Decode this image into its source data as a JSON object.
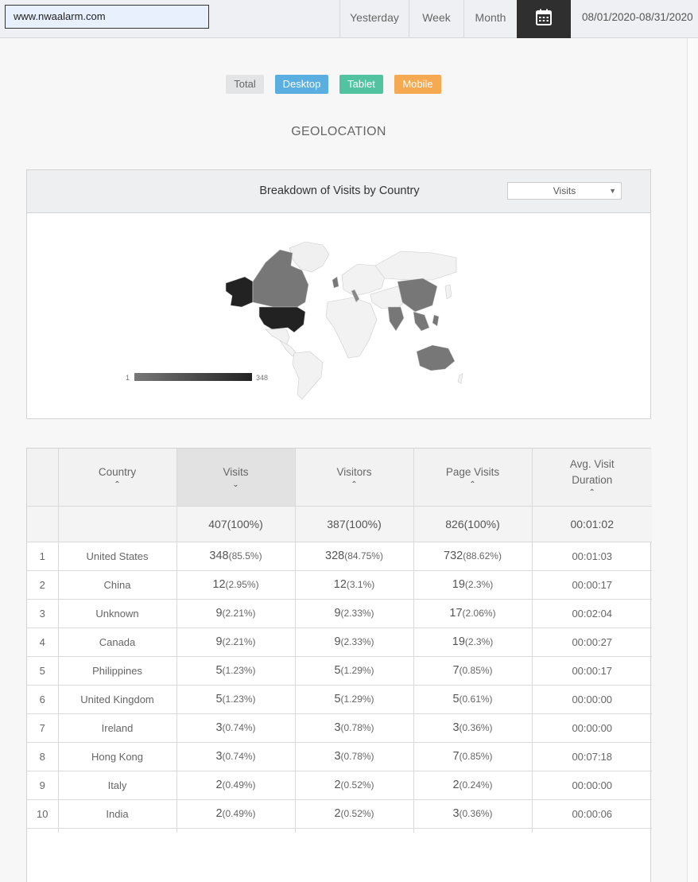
{
  "header": {
    "site": "www.nwaalarm.com",
    "nav": [
      "Yesterday",
      "Week",
      "Month"
    ],
    "calendar_icon": "calendar-icon",
    "date_range": "08/01/2020-08/31/2020"
  },
  "filters": [
    "Total",
    "Desktop",
    "Tablet",
    "Mobile"
  ],
  "filter_colors": {
    "total": "#e2e4e6",
    "desktop": "#5aaee0",
    "tablet": "#52c3a0",
    "mobile": "#f5a950"
  },
  "section_title": "GEOLOCATION",
  "map_panel": {
    "title": "Breakdown of Visits by Country",
    "metric_selected": "Visits",
    "legend_min": "1",
    "legend_max": "348"
  },
  "table": {
    "columns": [
      "",
      "Country",
      "Visits",
      "Visitors",
      "Page Visits",
      "Avg. Visit Duration"
    ],
    "totals": {
      "visits": {
        "n": "407",
        "p": "(100%)"
      },
      "visitors": {
        "n": "387",
        "p": "(100%)"
      },
      "page_visits": {
        "n": "826",
        "p": "(100%)"
      },
      "duration": "00:01:02"
    },
    "rows": [
      {
        "idx": "1",
        "country": "United States",
        "visits": {
          "n": "348",
          "p": "(85.5%)"
        },
        "visitors": {
          "n": "328",
          "p": "(84.75%)"
        },
        "page_visits": {
          "n": "732",
          "p": "(88.62%)"
        },
        "duration": "00:01:03"
      },
      {
        "idx": "2",
        "country": "China",
        "visits": {
          "n": "12",
          "p": "(2.95%)"
        },
        "visitors": {
          "n": "12",
          "p": "(3.1%)"
        },
        "page_visits": {
          "n": "19",
          "p": "(2.3%)"
        },
        "duration": "00:00:17"
      },
      {
        "idx": "3",
        "country": "Unknown",
        "visits": {
          "n": "9",
          "p": "(2.21%)"
        },
        "visitors": {
          "n": "9",
          "p": "(2.33%)"
        },
        "page_visits": {
          "n": "17",
          "p": "(2.06%)"
        },
        "duration": "00:02:04"
      },
      {
        "idx": "4",
        "country": "Canada",
        "visits": {
          "n": "9",
          "p": "(2.21%)"
        },
        "visitors": {
          "n": "9",
          "p": "(2.33%)"
        },
        "page_visits": {
          "n": "19",
          "p": "(2.3%)"
        },
        "duration": "00:00:27"
      },
      {
        "idx": "5",
        "country": "Philippines",
        "visits": {
          "n": "5",
          "p": "(1.23%)"
        },
        "visitors": {
          "n": "5",
          "p": "(1.29%)"
        },
        "page_visits": {
          "n": "7",
          "p": "(0.85%)"
        },
        "duration": "00:00:17"
      },
      {
        "idx": "6",
        "country": "United Kingdom",
        "visits": {
          "n": "5",
          "p": "(1.23%)"
        },
        "visitors": {
          "n": "5",
          "p": "(1.29%)"
        },
        "page_visits": {
          "n": "5",
          "p": "(0.61%)"
        },
        "duration": "00:00:00"
      },
      {
        "idx": "7",
        "country": "Ireland",
        "visits": {
          "n": "3",
          "p": "(0.74%)"
        },
        "visitors": {
          "n": "3",
          "p": "(0.78%)"
        },
        "page_visits": {
          "n": "3",
          "p": "(0.36%)"
        },
        "duration": "00:00:00"
      },
      {
        "idx": "8",
        "country": "Hong Kong",
        "visits": {
          "n": "3",
          "p": "(0.74%)"
        },
        "visitors": {
          "n": "3",
          "p": "(0.78%)"
        },
        "page_visits": {
          "n": "7",
          "p": "(0.85%)"
        },
        "duration": "00:07:18"
      },
      {
        "idx": "9",
        "country": "Italy",
        "visits": {
          "n": "2",
          "p": "(0.49%)"
        },
        "visitors": {
          "n": "2",
          "p": "(0.52%)"
        },
        "page_visits": {
          "n": "2",
          "p": "(0.24%)"
        },
        "duration": "00:00:00"
      },
      {
        "idx": "10",
        "country": "India",
        "visits": {
          "n": "2",
          "p": "(0.49%)"
        },
        "visitors": {
          "n": "2",
          "p": "(0.52%)"
        },
        "page_visits": {
          "n": "3",
          "p": "(0.36%)"
        },
        "duration": "00:00:06"
      }
    ]
  }
}
